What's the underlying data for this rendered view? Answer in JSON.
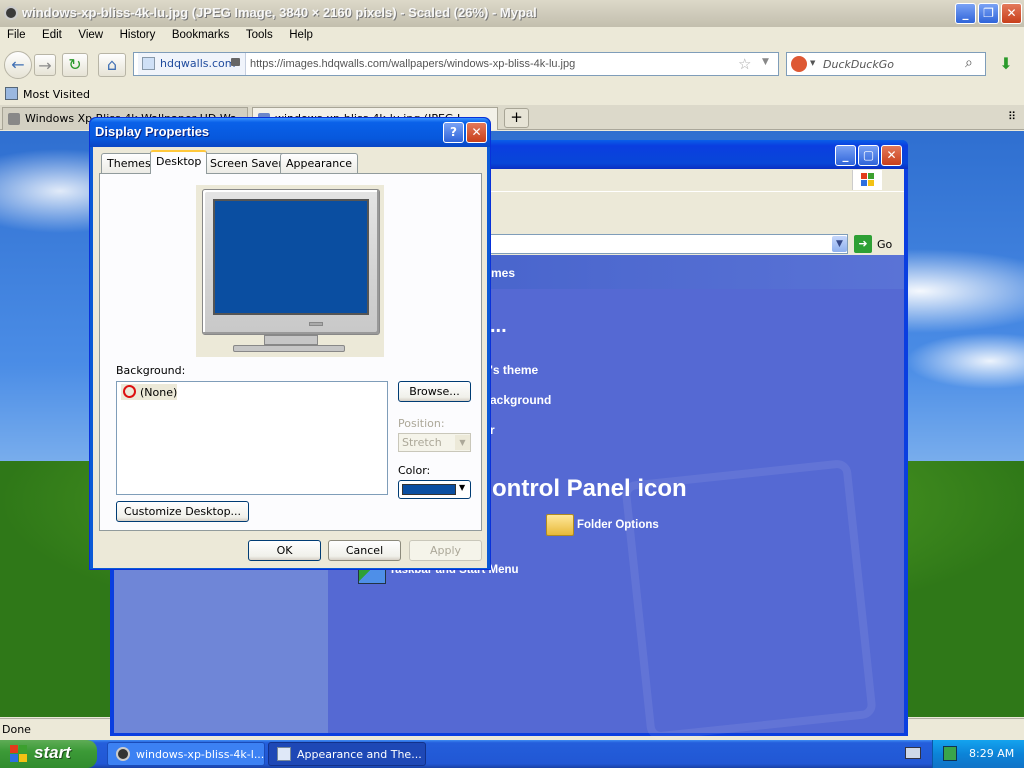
{
  "browser": {
    "title": "windows-xp-bliss-4k-lu.jpg (JPEG Image, 3840 × 2160 pixels) - Scaled (26%) - Mypal",
    "menu": [
      "File",
      "Edit",
      "View",
      "History",
      "Bookmarks",
      "Tools",
      "Help"
    ],
    "site_identity": "hdqwalls.com",
    "url": "https://images.hdqwalls.com/wallpapers/windows-xp-bliss-4k-lu.jpg",
    "search_placeholder": "DuckDuckGo",
    "bookmarks": [
      "Most Visited"
    ],
    "tabs": [
      {
        "label": "Windows Xp Bliss 4k Wallpaper,HD Wa..."
      },
      {
        "label": "windows-xp-bliss-4k-lu.jpg (JPEG I..."
      }
    ],
    "status": "Done"
  },
  "control_panel": {
    "heading_fragment_1": "mes",
    "task_1": "'s theme",
    "task_2": "ackground",
    "task_3": "r",
    "ellipsis": "...",
    "pick_icon_heading": "ontrol Panel icon",
    "icon_folder_options": "Folder Options",
    "icon_taskbar": "Taskbar and Start Menu",
    "go_label": "Go"
  },
  "dialog": {
    "title": "Display Properties",
    "tabs": [
      "Themes",
      "Desktop",
      "Screen Saver",
      "Appearance"
    ],
    "active_tab": "Desktop",
    "background_label": "Background:",
    "background_items": [
      "(None)"
    ],
    "browse_button": "Browse...",
    "position_label": "Position:",
    "position_value": "Stretch",
    "color_label": "Color:",
    "color_value": "#0a4ea1",
    "customize_button": "Customize Desktop...",
    "ok_button": "OK",
    "cancel_button": "Cancel",
    "apply_button": "Apply"
  },
  "taskbar": {
    "start_label": "start",
    "items": [
      "windows-xp-bliss-4k-l...",
      "Appearance and The..."
    ],
    "clock": "8:29 AM"
  },
  "colors": {
    "xp_blue_title": "#0a5fe8",
    "start_green": "#3c9a37",
    "cp_body": "#5569d3",
    "desktop_preview": "#0a4ea1"
  }
}
